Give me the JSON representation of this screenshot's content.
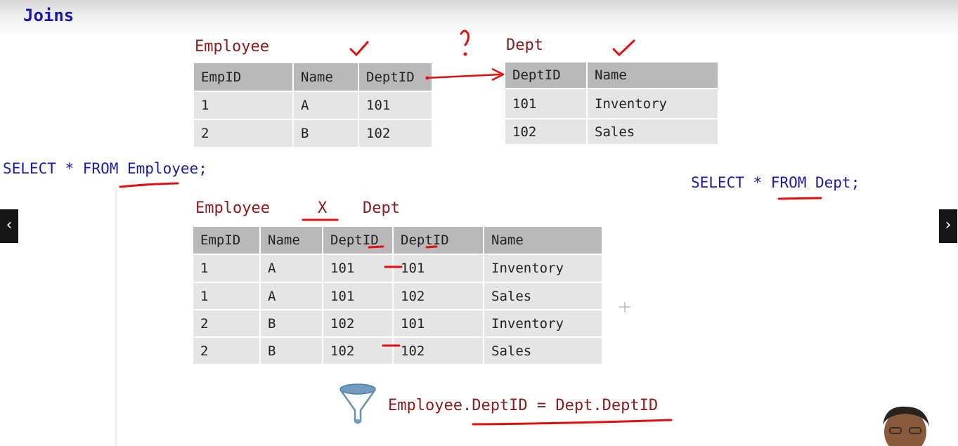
{
  "slide": {
    "title": "Joins"
  },
  "employee_table": {
    "label": "Employee",
    "headers": [
      "EmpID",
      "Name",
      "DeptID"
    ],
    "rows": [
      [
        "1",
        "A",
        "101"
      ],
      [
        "2",
        "B",
        "102"
      ]
    ]
  },
  "dept_table": {
    "label": "Dept",
    "headers": [
      "DeptID",
      "Name"
    ],
    "rows": [
      [
        "101",
        "Inventory"
      ],
      [
        "102",
        "Sales"
      ]
    ]
  },
  "annotations": {
    "question_mark": "?",
    "check_mark": "✓"
  },
  "queries": {
    "select_employee": "SELECT * FROM Employee;",
    "select_dept": "SELECT * FROM Dept;"
  },
  "cross_product": {
    "left": "Employee",
    "operator": "X",
    "right": "Dept",
    "headers": [
      "EmpID",
      "Name",
      "DeptID",
      "DeptID",
      "Name"
    ],
    "rows": [
      [
        "1",
        "A",
        "101",
        "101",
        "Inventory"
      ],
      [
        "1",
        "A",
        "101",
        "102",
        "Sales"
      ],
      [
        "2",
        "B",
        "102",
        "101",
        "Inventory"
      ],
      [
        "2",
        "B",
        "102",
        "102",
        "Sales"
      ]
    ]
  },
  "filter": {
    "icon": "funnel-icon",
    "condition": "Employee.DeptID = Dept.DeptID"
  },
  "nav": {
    "prev_icon": "‹",
    "next_icon": "›"
  },
  "colors": {
    "title_blue": "#1a1aa6",
    "label_red": "#8b1a1a",
    "ink_red": "#e01010",
    "header_gray": "#b9b9b9",
    "cell_gray": "#e5e5e5"
  }
}
